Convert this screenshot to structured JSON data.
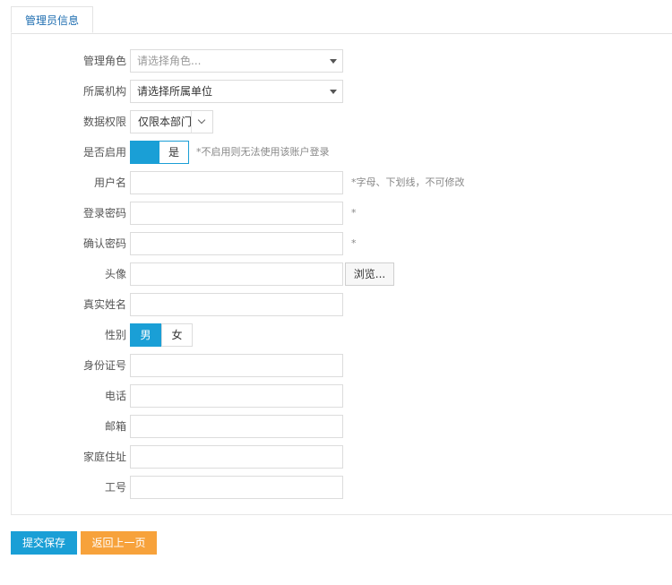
{
  "tab": {
    "label": "管理员信息"
  },
  "form": {
    "role": {
      "label": "管理角色",
      "placeholder": "请选择角色..."
    },
    "org": {
      "label": "所属机构",
      "value": "请选择所属单位"
    },
    "scope": {
      "label": "数据权限",
      "value": "仅限本部门"
    },
    "enabled": {
      "label": "是否启用",
      "state": "是",
      "hint": "*不启用则无法使用该账户登录"
    },
    "username": {
      "label": "用户名",
      "value": "",
      "hint": "*字母、下划线，不可修改"
    },
    "password": {
      "label": "登录密码",
      "value": "",
      "hint": "*"
    },
    "confirm": {
      "label": "确认密码",
      "value": "",
      "hint": "*"
    },
    "avatar": {
      "label": "头像",
      "value": "",
      "browse": "浏览..."
    },
    "realname": {
      "label": "真实姓名",
      "value": ""
    },
    "gender": {
      "label": "性别",
      "options": [
        "男",
        "女"
      ],
      "selected": "男"
    },
    "idcard": {
      "label": "身份证号",
      "value": ""
    },
    "phone": {
      "label": "电话",
      "value": ""
    },
    "email": {
      "label": "邮箱",
      "value": ""
    },
    "address": {
      "label": "家庭住址",
      "value": ""
    },
    "employee_no": {
      "label": "工号",
      "value": ""
    }
  },
  "actions": {
    "save": "提交保存",
    "back": "返回上一页"
  },
  "colors": {
    "primary": "#1a9fd6",
    "secondary": "#f7a23b",
    "tab_text": "#1e6db0"
  }
}
